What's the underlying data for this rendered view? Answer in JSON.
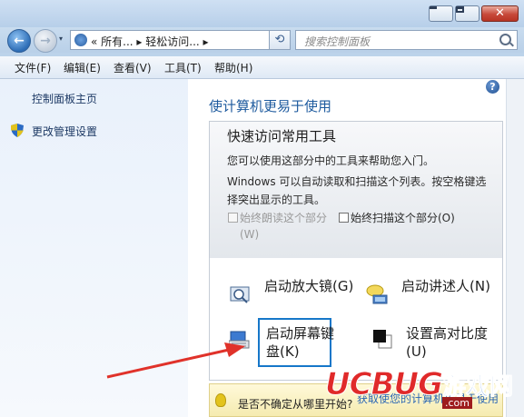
{
  "window": {
    "close_glyph": "✕",
    "nav_back_glyph": "←",
    "nav_forward_glyph": "→"
  },
  "address": {
    "path_text": "« 所有... ▸ 轻松访问... ▸",
    "dropdown_glyph": "▾",
    "refresh_glyph": "⟲"
  },
  "search": {
    "placeholder": "搜索控制面板"
  },
  "menu": {
    "items": [
      "文件(F)",
      "编辑(E)",
      "查看(V)",
      "工具(T)",
      "帮助(H)"
    ]
  },
  "sidebar": {
    "home": "控制面板主页",
    "uac": "更改管理设置"
  },
  "main": {
    "help_glyph": "?",
    "title": "使计算机更易于使用",
    "panel_title": "快速访问常用工具",
    "desc1": "您可以使用这部分中的工具来帮助您入门。",
    "desc2": "Windows 可以自动读取和扫描这个列表。按空格键选择突出显示的工具。",
    "checkbox_read": "始终朗读这个部分(W)",
    "checkbox_scan": "始终扫描这个部分(O)",
    "tools": {
      "magnifier": "启动放大镜(G)",
      "narrator": "启动讲述人(N)",
      "osk": "启动屏幕键盘(K)",
      "contrast": "设置高对比度(U)"
    },
    "bottom_text": "是否不确定从哪里开始?",
    "bottom_link": "获取使您的计算机更易于使用"
  },
  "watermark": {
    "logo": "UCBUG",
    "cn": "游戏网",
    "url": ".com"
  },
  "colors": {
    "accent_blue": "#1d5a9e",
    "highlight_box": "#1677c9",
    "arrow_red": "#e0322a"
  }
}
